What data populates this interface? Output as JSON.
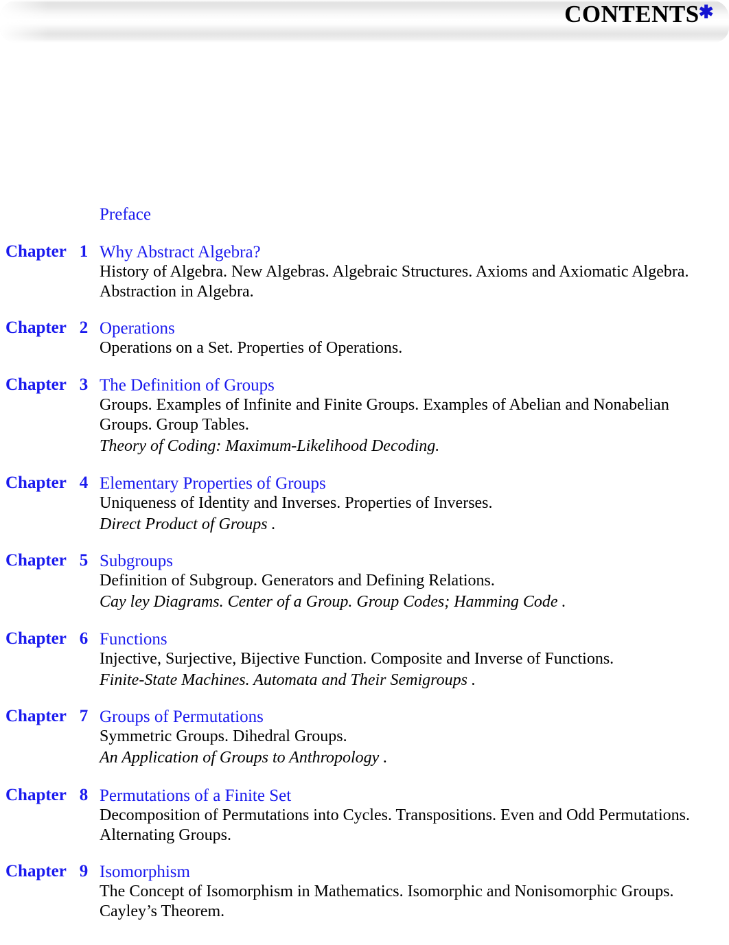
{
  "header": {
    "title": "CONTENTS",
    "marker": "✱",
    "marker_icon": "asterisk-icon",
    "marker_color": "#1414d2"
  },
  "colors": {
    "link_blue": "#1a1aee",
    "body_black": "#000000",
    "page_background": "#ffffff"
  },
  "toc": {
    "preface_label": "Preface",
    "chapter_word": "Chapter",
    "entries": [
      {
        "number": "1",
        "title": "Why Abstract Algebra?",
        "description_lines": [
          "History of Algebra. New Algebras. Algebraic Structures. Axioms and Axiomatic Algebra.",
          "Abstraction in Algebra."
        ],
        "italic_lines": []
      },
      {
        "number": "2",
        "title": "Operations",
        "description_lines": [
          "Operations on a Set. Properties of Operations."
        ],
        "italic_lines": []
      },
      {
        "number": "3",
        "title": "The Definition of Groups",
        "description_lines": [
          "Groups. Examples of Infinite and Finite Groups. Examples of Abelian and Nonabelian",
          "Groups. Group Tables."
        ],
        "italic_lines": [
          "Theory of Coding: Maximum-Likelihood Decoding."
        ]
      },
      {
        "number": "4",
        "title": "Elementary Properties of Groups",
        "description_lines": [
          "Uniqueness of Identity and Inverses. Properties of Inverses."
        ],
        "italic_lines": [
          "Direct Product of Groups ."
        ]
      },
      {
        "number": "5",
        "title": "Subgroups",
        "description_lines": [
          "Definition of Subgroup. Generators and Defining Relations."
        ],
        "italic_lines": [
          "Cay ley Diagrams. Center of a Group. Group Codes; Hamming Code ."
        ]
      },
      {
        "number": "6",
        "title": "Functions",
        "description_lines": [
          "Injective, Surjective, Bijective Function. Composite and Inverse of Functions."
        ],
        "italic_lines": [
          "Finite-State Machines. Automata and Their Semigroups ."
        ]
      },
      {
        "number": "7",
        "title": "Groups of Permutations",
        "description_lines": [
          "Symmetric Groups. Dihedral Groups."
        ],
        "italic_lines": [
          "An Application of Groups to Anthropology ."
        ]
      },
      {
        "number": "8",
        "title": "Permutations of a Finite Set",
        "description_lines": [
          "Decomposition of Permutations into Cycles. Transpositions. Even and Odd Permutations.",
          "Alternating Groups."
        ],
        "italic_lines": []
      },
      {
        "number": "9",
        "title": "Isomorphism",
        "description_lines": [
          "The Concept of Isomorphism in Mathematics. Isomorphic and Nonisomorphic Groups.",
          "Cayley’s Theorem."
        ],
        "italic_lines": []
      }
    ]
  },
  "layout": {
    "entry_tops": [
      353,
      464,
      547,
      690,
      803,
      917,
      1030,
      1145,
      1256
    ]
  }
}
